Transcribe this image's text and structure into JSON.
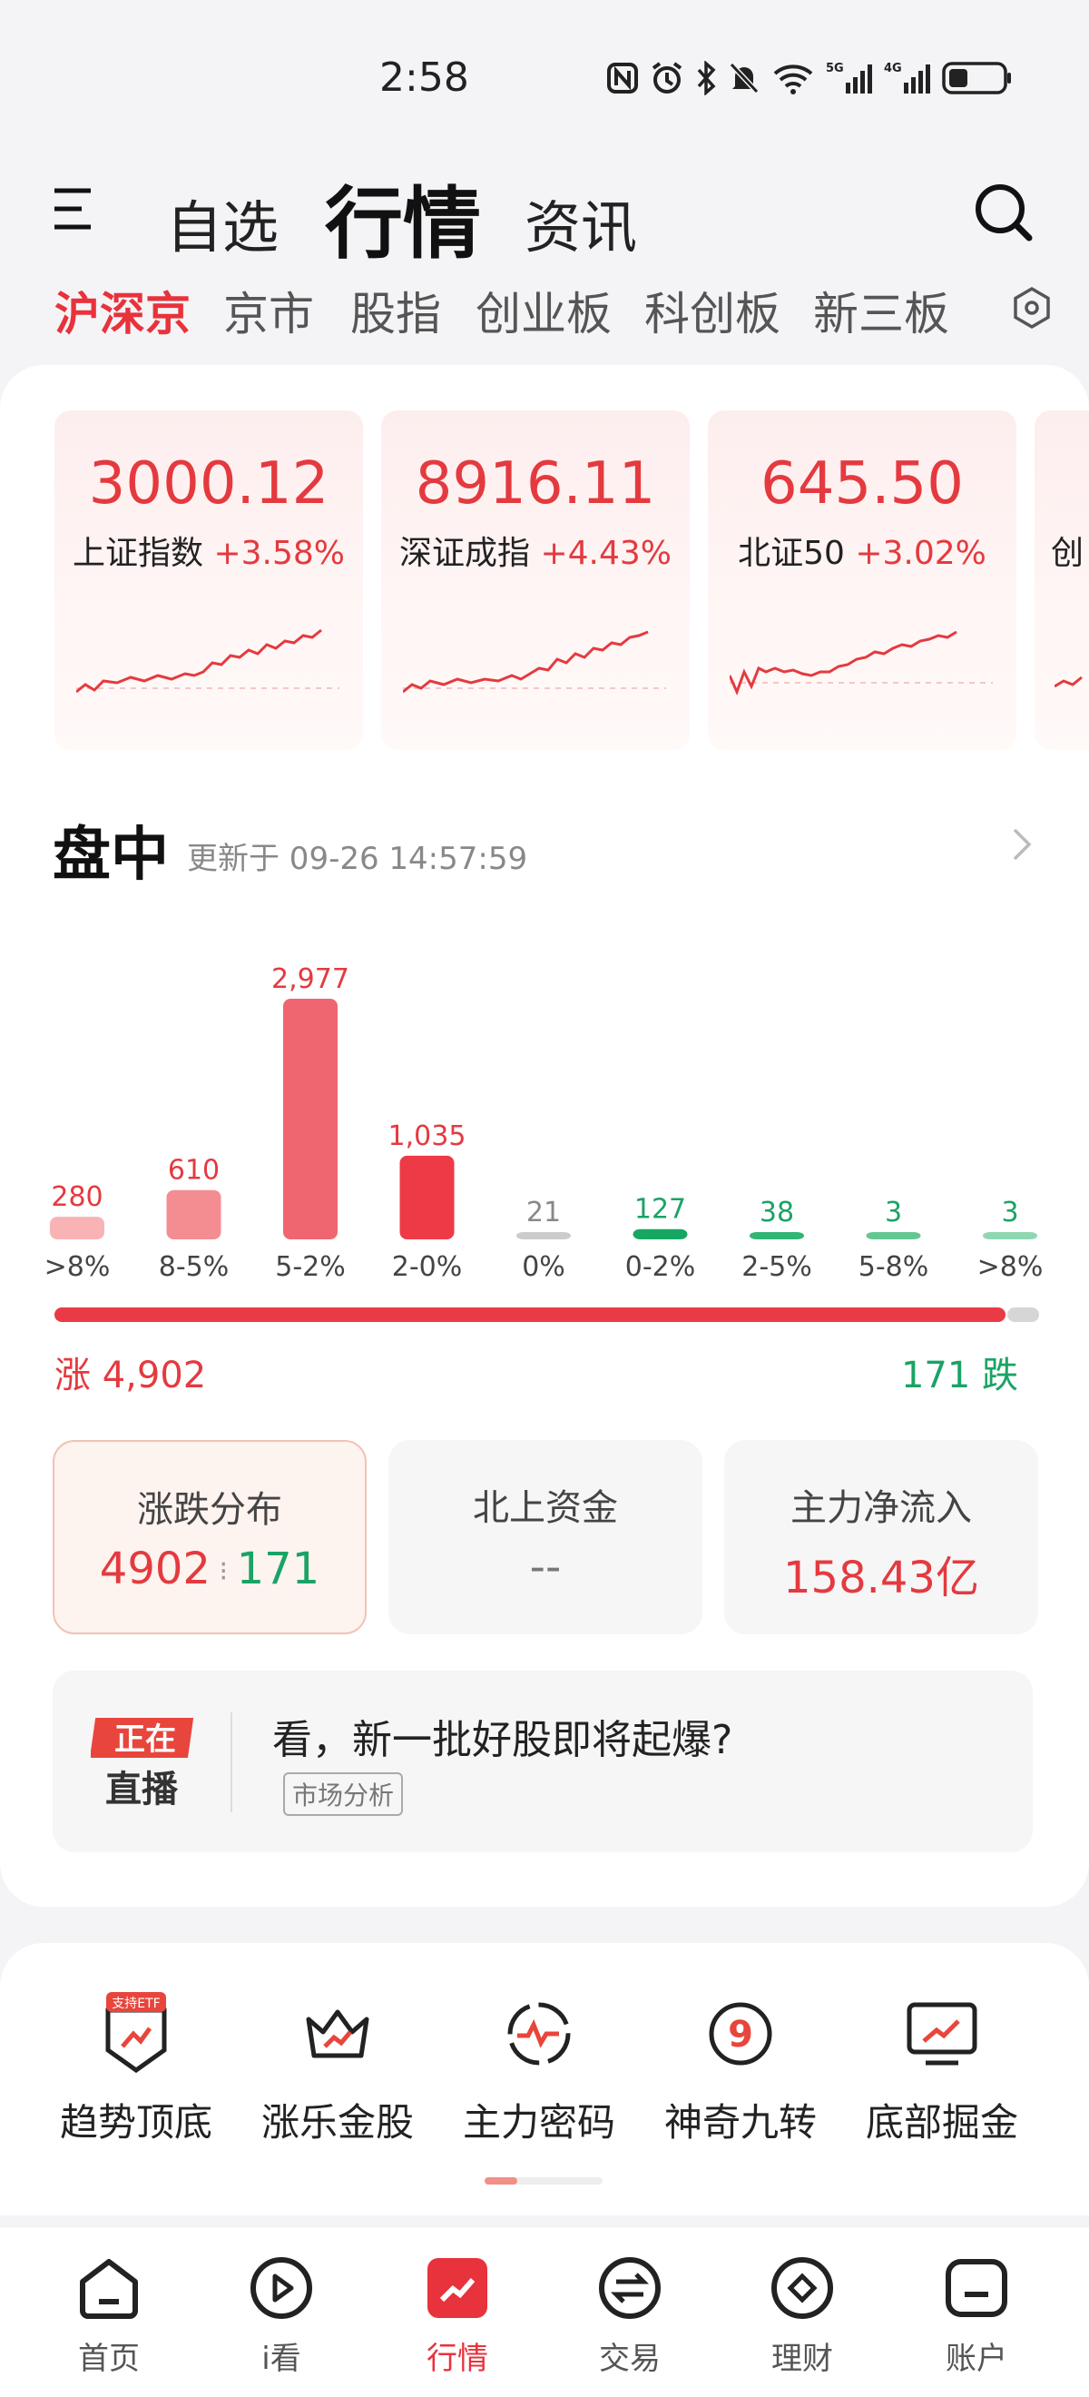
{
  "status_bar": {
    "time": "2:58",
    "icons": [
      "nfc-icon",
      "alarm-icon",
      "bluetooth-icon",
      "mute-icon",
      "wifi-icon",
      "signal-5g-icon",
      "signal-4g-icon",
      "battery-icon"
    ]
  },
  "header": {
    "tabs": [
      "自选",
      "行情",
      "资讯"
    ],
    "active_tab": "行情"
  },
  "subtabs": {
    "items": [
      "沪深京",
      "京市",
      "股指",
      "创业板",
      "科创板",
      "新三板"
    ],
    "active": "沪深京"
  },
  "indices": [
    {
      "value": "3000.12",
      "name": "上证指数",
      "change": "+3.58%"
    },
    {
      "value": "8916.11",
      "name": "深证成指",
      "change": "+4.43%"
    },
    {
      "value": "645.50",
      "name": "北证50",
      "change": "+3.02%"
    },
    {
      "value": "",
      "name": "创",
      "change": ""
    }
  ],
  "market": {
    "title": "盘中",
    "updated": "更新于 09-26 14:57:59"
  },
  "chart_data": {
    "type": "bar",
    "categories": [
      ">8%",
      "8-5%",
      "5-2%",
      "2-0%",
      "0%",
      "0-2%",
      "2-5%",
      "5-8%",
      ">8%"
    ],
    "values": [
      280,
      610,
      2977,
      1035,
      21,
      127,
      38,
      3,
      3
    ],
    "value_labels": [
      "280",
      "610",
      "2,977",
      "1,035",
      "21",
      "127",
      "38",
      "3",
      "3"
    ],
    "colors": [
      "#f9b3b5",
      "#f48d92",
      "#f06670",
      "#ee3a46",
      "#cccccc",
      "#16a862",
      "#2fb574",
      "#63c792",
      "#8ed7b0"
    ],
    "label_colors": [
      "#e43a3f",
      "#e43a3f",
      "#e43a3f",
      "#e43a3f",
      "#888888",
      "#1aa365",
      "#1aa365",
      "#1aa365",
      "#1aa365"
    ]
  },
  "summary": {
    "up_label": "涨 4,902",
    "down_label": "171 跌",
    "up_fraction": 0.966
  },
  "stats": [
    {
      "title": "涨跌分布",
      "up": "4902",
      "down": "171"
    },
    {
      "title": "北上资金",
      "value": "--"
    },
    {
      "title": "主力净流入",
      "value": "158.43亿"
    }
  ],
  "live": {
    "badge_top": "正在",
    "badge_bottom": "直播",
    "title": "看，新一批好股即将起爆?",
    "tag": "市场分析"
  },
  "tools": [
    {
      "label": "趋势顶底",
      "badge": "支持ETF"
    },
    {
      "label": "涨乐金股"
    },
    {
      "label": "主力密码"
    },
    {
      "label": "神奇九转"
    },
    {
      "label": "底部掘金"
    }
  ],
  "bottom_nav": {
    "items": [
      "首页",
      "i看",
      "行情",
      "交易",
      "理财",
      "账户"
    ],
    "active": "行情"
  },
  "colors": {
    "red": "#e43a3f",
    "green": "#1aa365",
    "accent": "#e8323c"
  }
}
